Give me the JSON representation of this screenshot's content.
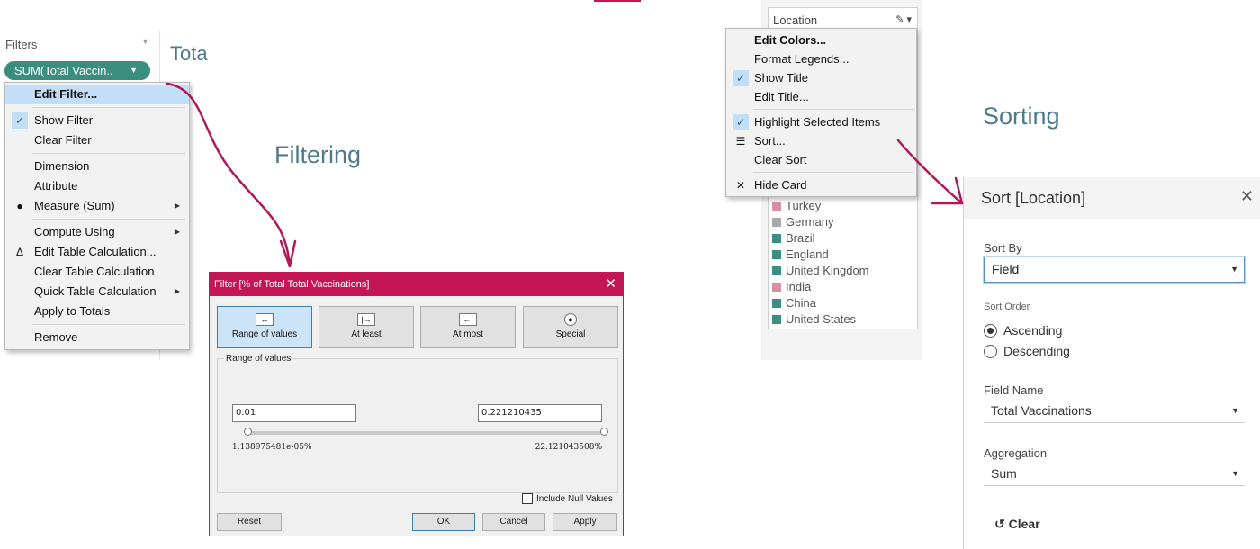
{
  "filters_shelf": {
    "title": "Filters",
    "pill_label": "SUM(Total Vaccin..",
    "view_title": "Tota"
  },
  "filter_menu": {
    "items": [
      {
        "label": "Edit Filter...",
        "bold": true,
        "highlighted": true
      },
      {
        "label": "Show Filter",
        "checked": true
      },
      {
        "label": "Clear Filter"
      },
      {
        "label": "Dimension"
      },
      {
        "label": "Attribute"
      },
      {
        "label": "Measure (Sum)",
        "bullet": true,
        "submenu": true
      },
      {
        "label": "Compute Using",
        "submenu": true
      },
      {
        "label": "Edit Table Calculation...",
        "icon": "delta-icon"
      },
      {
        "label": "Clear Table Calculation"
      },
      {
        "label": "Quick Table Calculation",
        "submenu": true
      },
      {
        "label": "Apply to Totals"
      },
      {
        "label": "Remove"
      }
    ]
  },
  "headings": {
    "filtering": "Filtering",
    "sorting": "Sorting"
  },
  "filter_dialog": {
    "title": "Filter [% of Total Total Vaccinations]",
    "modes": [
      {
        "label": "Range of values",
        "icon": "range-icon",
        "selected": true
      },
      {
        "label": "At least",
        "icon": "at-least-icon"
      },
      {
        "label": "At most",
        "icon": "at-most-icon"
      },
      {
        "label": "Special",
        "icon": "special-icon"
      }
    ],
    "group_label": "Range of values",
    "min_value": "0.01",
    "max_value": "0.221210435",
    "range_min_label": "1.138975481e-05%",
    "range_max_label": "22.121043508%",
    "include_null_label": "Include Null Values",
    "include_null_checked": false,
    "buttons": {
      "reset": "Reset",
      "ok": "OK",
      "cancel": "Cancel",
      "apply": "Apply"
    }
  },
  "legend": {
    "title": "Location",
    "items": [
      {
        "label": "Turkey",
        "color": "#d98fa5",
        "pattern": true
      },
      {
        "label": "Germany",
        "color": "#a9a9a9"
      },
      {
        "label": "Brazil",
        "color": "#3e8f83",
        "pattern": true
      },
      {
        "label": "England",
        "color": "#3e8f83"
      },
      {
        "label": "United Kingdom",
        "color": "#3e8f83",
        "pattern": true
      },
      {
        "label": "India",
        "color": "#d98fa5",
        "pattern": true
      },
      {
        "label": "China",
        "color": "#3e8f83"
      },
      {
        "label": "United States",
        "color": "#3e8f83",
        "pattern": true
      }
    ]
  },
  "legend_menu": {
    "items": [
      {
        "label": "Edit Colors...",
        "bold": true
      },
      {
        "label": "Format Legends..."
      },
      {
        "label": "Show Title",
        "checked": true
      },
      {
        "label": "Edit Title..."
      },
      {
        "label": "Highlight Selected Items",
        "checked": true
      },
      {
        "label": "Sort...",
        "icon": "sort-icon"
      },
      {
        "label": "Clear Sort"
      },
      {
        "label": "Hide Card",
        "icon": "close-icon"
      }
    ]
  },
  "sort_panel": {
    "title": "Sort [Location]",
    "sort_by_label": "Sort By",
    "sort_by_value": "Field",
    "sort_order_label": "Sort Order",
    "ascending_label": "Ascending",
    "descending_label": "Descending",
    "order": "ascending",
    "field_name_label": "Field Name",
    "field_name_value": "Total Vaccinations",
    "aggregation_label": "Aggregation",
    "aggregation_value": "Sum",
    "clear_label": "Clear"
  },
  "colors": {
    "accent": "#c41654",
    "heading": "#4e7a8c",
    "pill": "#3b8d7e",
    "menu_highlight": "#c2dff7"
  }
}
